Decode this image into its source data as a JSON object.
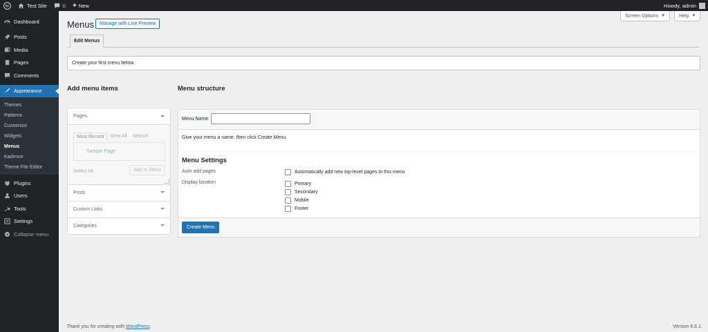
{
  "admin_bar": {
    "site_name": "Test Site",
    "comments_count": "0",
    "new_label": "New",
    "howdy": "Howdy, admin"
  },
  "sidebar": {
    "items": [
      {
        "label": "Dashboard",
        "icon": "dashboard-icon"
      },
      {
        "label": "Posts",
        "icon": "pin-icon"
      },
      {
        "label": "Media",
        "icon": "media-icon"
      },
      {
        "label": "Pages",
        "icon": "pages-icon"
      },
      {
        "label": "Comments",
        "icon": "comments-icon"
      },
      {
        "label": "Appearance",
        "icon": "brush-icon"
      },
      {
        "label": "Plugins",
        "icon": "plugin-icon"
      },
      {
        "label": "Users",
        "icon": "users-icon"
      },
      {
        "label": "Tools",
        "icon": "wrench-icon"
      },
      {
        "label": "Settings",
        "icon": "settings-icon"
      },
      {
        "label": "Collapse menu",
        "icon": "collapse-icon"
      }
    ],
    "appearance_submenu": [
      "Themes",
      "Patterns",
      "Customize",
      "Widgets",
      "Menus",
      "Kadence",
      "Theme File Editor"
    ]
  },
  "header": {
    "screen_options": "Screen Options",
    "help": "Help",
    "title": "Menus",
    "live_preview": "Manage with Live Preview",
    "tab": "Edit Menus"
  },
  "notice": "Create your first menu below.",
  "add_items": {
    "title": "Add menu items",
    "sections": [
      "Pages",
      "Posts",
      "Custom Links",
      "Categories"
    ],
    "page_tabs": [
      "Most Recent",
      "View All",
      "Search"
    ],
    "page_item": "Sample Page",
    "select_all": "Select All",
    "add_to_menu": "Add to Menu"
  },
  "structure": {
    "title": "Menu structure",
    "menu_name_label": "Menu Name",
    "menu_name_value": "",
    "instructions": "Give your menu a name, then click Create Menu.",
    "settings_title": "Menu Settings",
    "auto_add_label": "Auto add pages",
    "auto_add_text": "Automatically add new top-level pages to this menu",
    "display_location_label": "Display location",
    "locations": [
      "Primary",
      "Secondary",
      "Mobile",
      "Footer"
    ],
    "create_button": "Create Menu"
  },
  "footer": {
    "thanks_prefix": "Thank you for creating with ",
    "thanks_link": "WordPress",
    "thanks_suffix": ".",
    "version": "Version 6.6.1"
  },
  "colors": {
    "accent": "#2271b1",
    "admin_dark": "#1d2327",
    "background": "#f0f0f1"
  }
}
